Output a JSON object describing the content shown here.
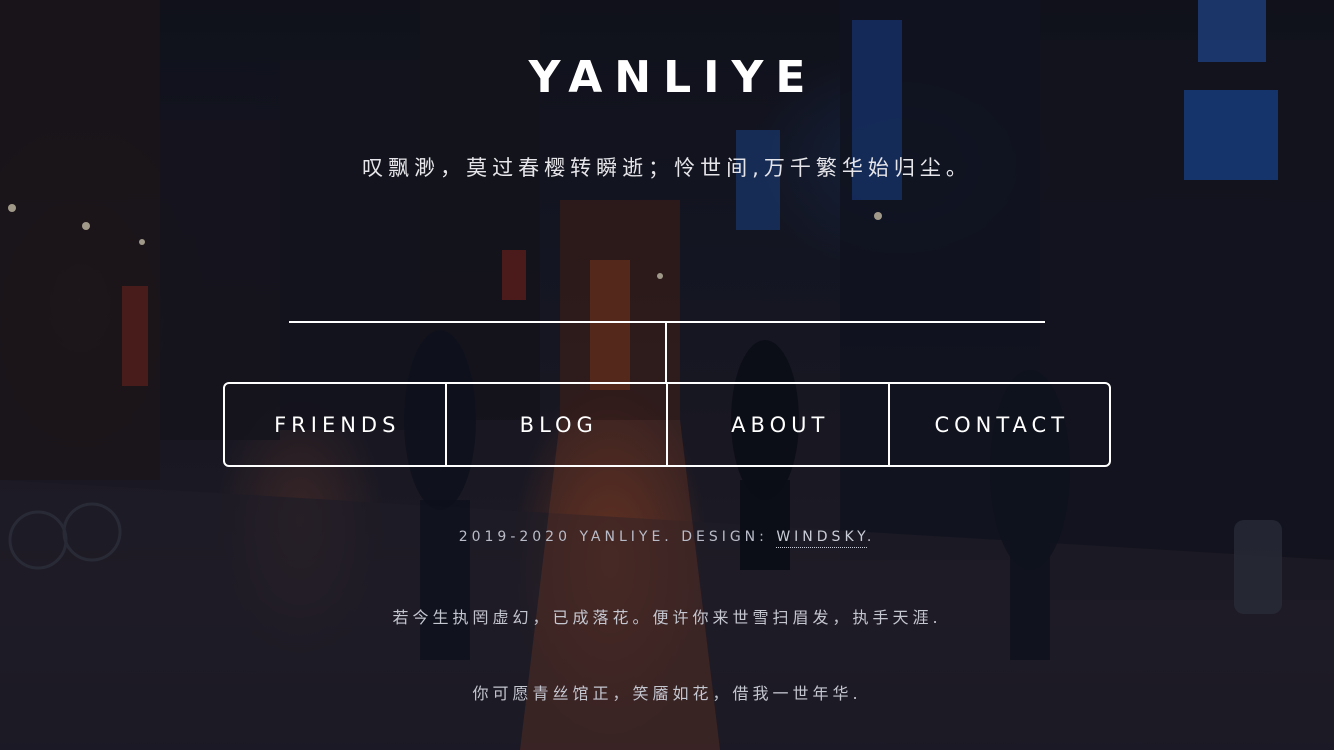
{
  "site": {
    "title": "YANLIYE",
    "subtitle": "叹飘渺，莫过春樱转瞬逝；怜世间,万千繁华始归尘。"
  },
  "nav": {
    "items": [
      {
        "label": "FRIENDS"
      },
      {
        "label": "BLOG"
      },
      {
        "label": "ABOUT"
      },
      {
        "label": "CONTACT"
      }
    ]
  },
  "footer": {
    "copyright_prefix": "2019-2020 YANLIYE. DESIGN: ",
    "designer_link": "WINDSKY",
    "copyright_suffix": ".",
    "quote_1": "若今生执罔虚幻，已成落花。便许你来世雪扫眉发，执手天涯.",
    "quote_2": "你可愿青丝馆正，笑靥如花，借我一世年华."
  },
  "colors": {
    "text_primary": "#ffffff",
    "text_muted": "#b9bcc8",
    "accent_warm": "#d65c26",
    "accent_cool": "#285aaa"
  }
}
